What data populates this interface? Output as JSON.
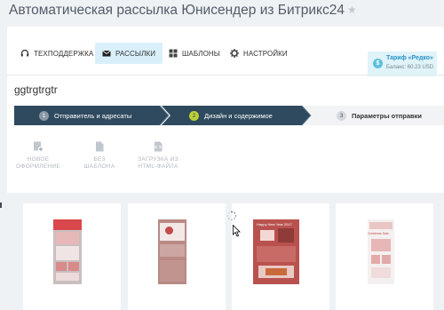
{
  "header": {
    "title": "Автоматическая рассылка Юнисендер из Битрикс24",
    "star_icon": "star-icon"
  },
  "nav": {
    "items": [
      {
        "label": "ТЕХПОДДЕРЖКА",
        "icon": "headset-icon"
      },
      {
        "label": "РАССЫЛКИ",
        "icon": "envelope-icon",
        "active": true
      },
      {
        "label": "ШАБЛОНЫ",
        "icon": "template-icon"
      },
      {
        "label": "НАСТРОЙКИ",
        "icon": "gear-icon"
      }
    ]
  },
  "tariff": {
    "badge": "$",
    "name": "Тариф «Редко»",
    "balance": "Баланс: 60.23 USD"
  },
  "mailing": {
    "name": "ggtrgtrgtr"
  },
  "steps": [
    {
      "number": "1",
      "label": "Отправитель и адресаты",
      "state": "done"
    },
    {
      "number": "2",
      "label": "Дизайн и содержимое",
      "state": "current"
    },
    {
      "number": "3",
      "label": "Параметры отправки",
      "state": "pending"
    }
  ],
  "tools": [
    {
      "line1": "НОВОЕ",
      "line2": "ОФОРМЛЕНИЕ",
      "icon": "new-design-icon"
    },
    {
      "line1": "БЕЗ",
      "line2": "ШАБЛОНА",
      "icon": "blank-page-icon"
    },
    {
      "line1": "ЗАГРУЗКА ИЗ",
      "line2": "HTML-ФАЙЛА",
      "icon": "html-file-icon"
    }
  ],
  "templates": {
    "loading_thumbnail_text": "Happy New Year 2017",
    "christmas_thumbnail_text": "Christmas Sale"
  },
  "colors": {
    "accent": "#2a93c9",
    "active_step": "#2f4a5e",
    "current_step_badge": "#bbd034",
    "nav_active_bg": "#d9f0fb",
    "thumb_red": "#c54b4b"
  }
}
